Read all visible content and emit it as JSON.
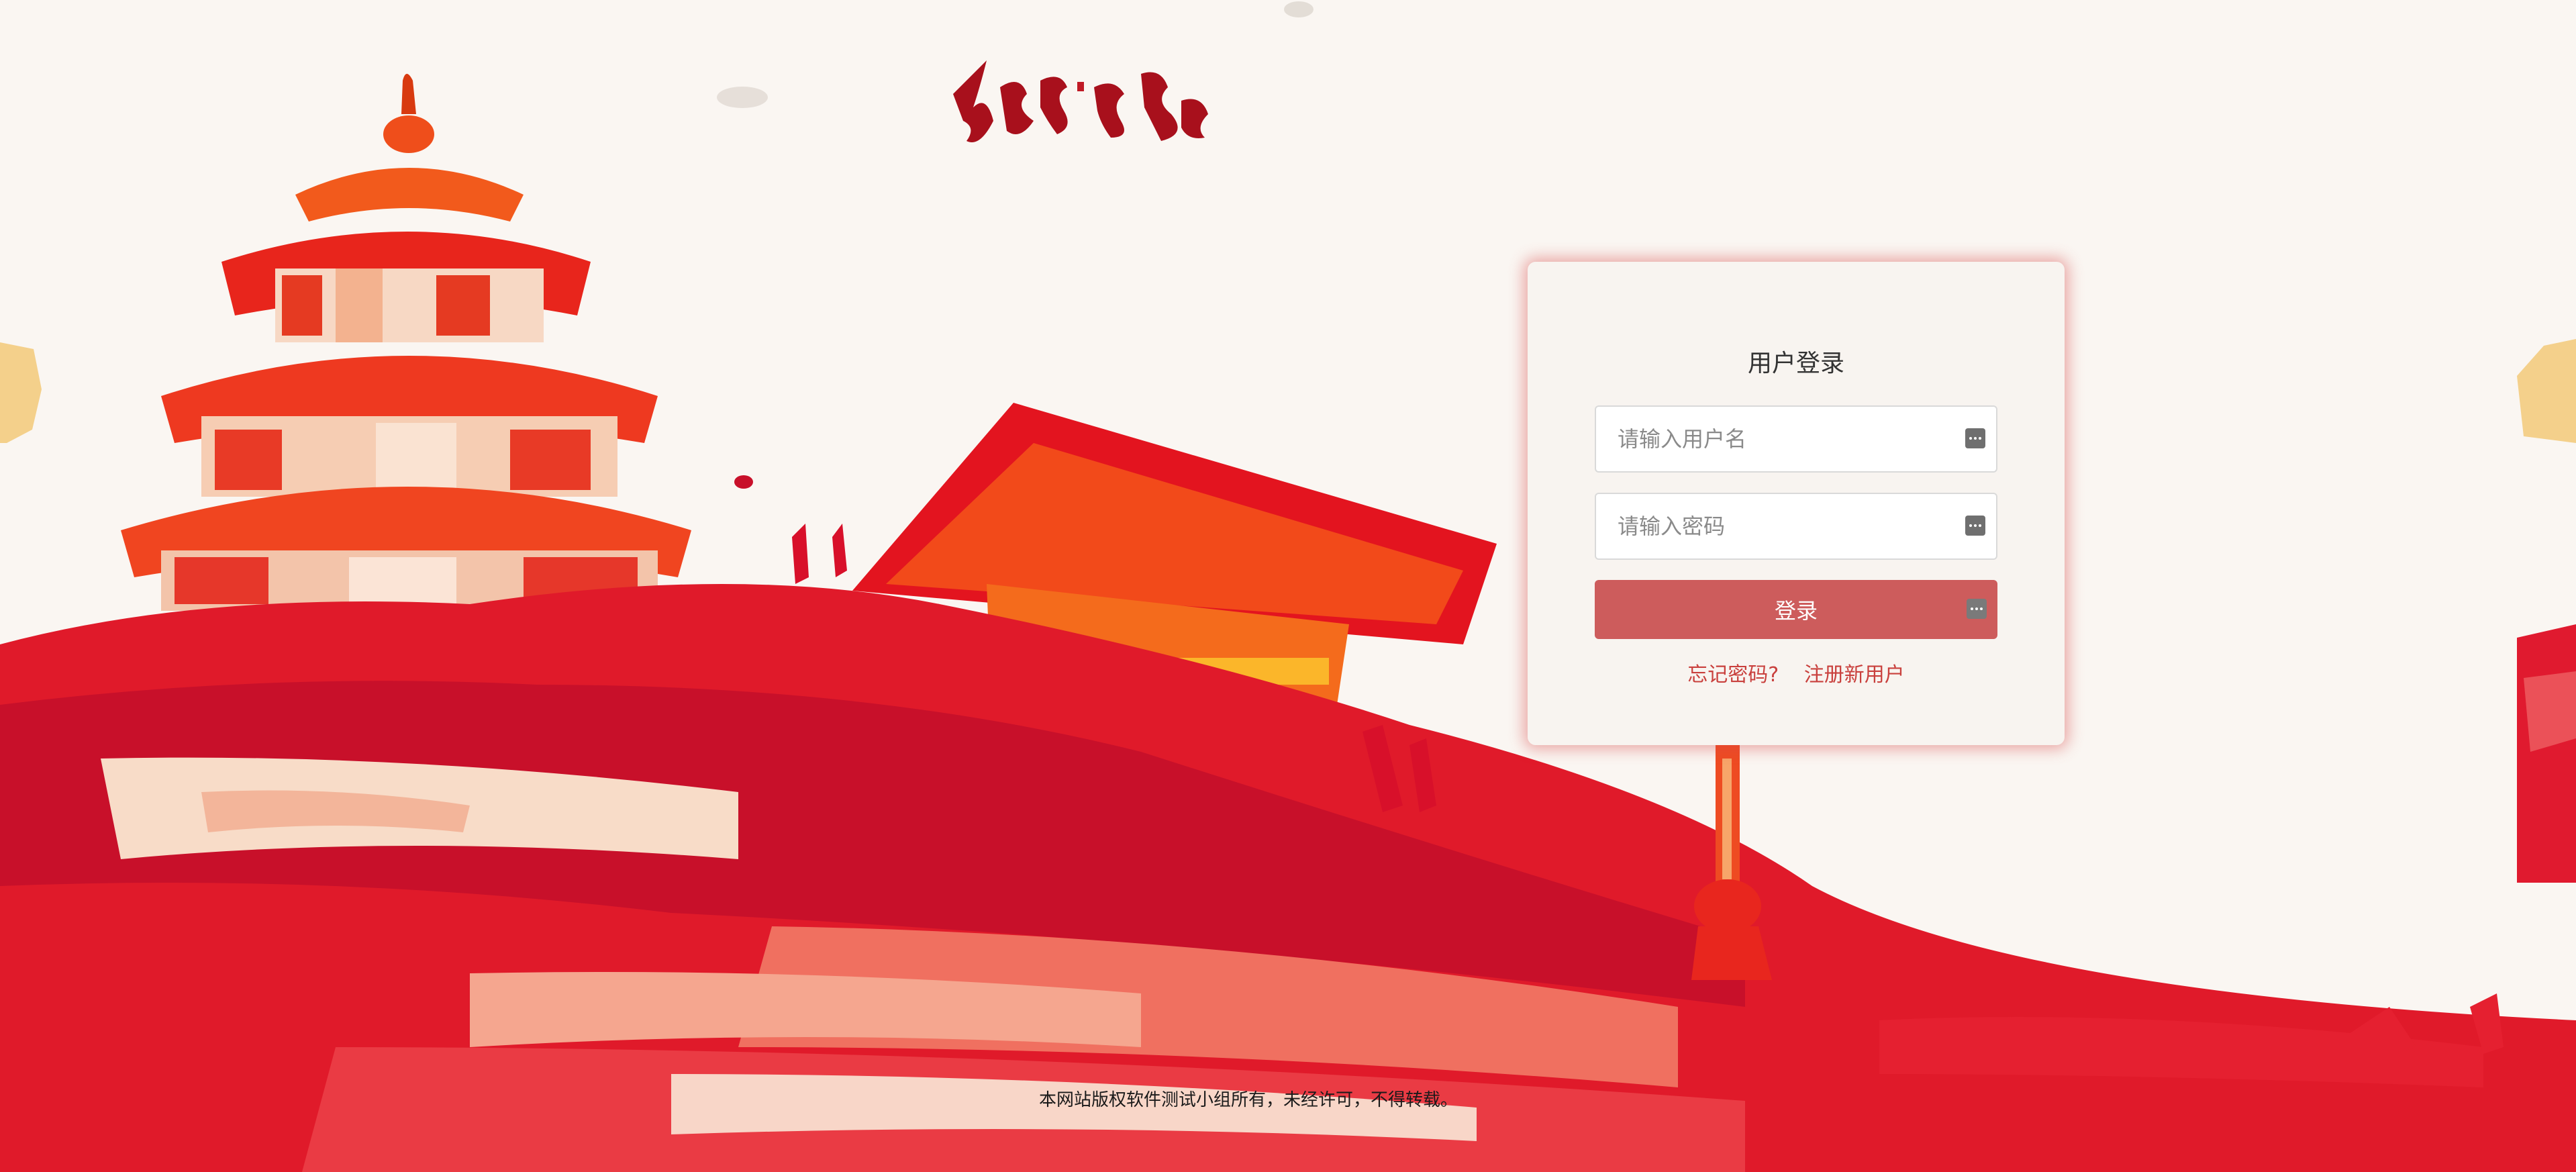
{
  "logo": {
    "text": "红色记忆"
  },
  "login": {
    "title": "用户登录",
    "username_placeholder": "请输入用户名",
    "password_placeholder": "请输入密码",
    "submit_label": "登录",
    "forgot_link": "忘记密码?",
    "register_link": "注册新用户"
  },
  "footer": {
    "text": "本网站版权软件测试小组所有，未经许可，不得转载。"
  },
  "icons": {
    "input_helper": "dots-icon",
    "login_helper": "dots-icon"
  },
  "colors": {
    "page_bg": "#faf6f2",
    "brand_red": "#cd5c5c",
    "link_red": "#c9403d",
    "art_red": "#e01a22",
    "art_orange": "#f25a1c"
  }
}
